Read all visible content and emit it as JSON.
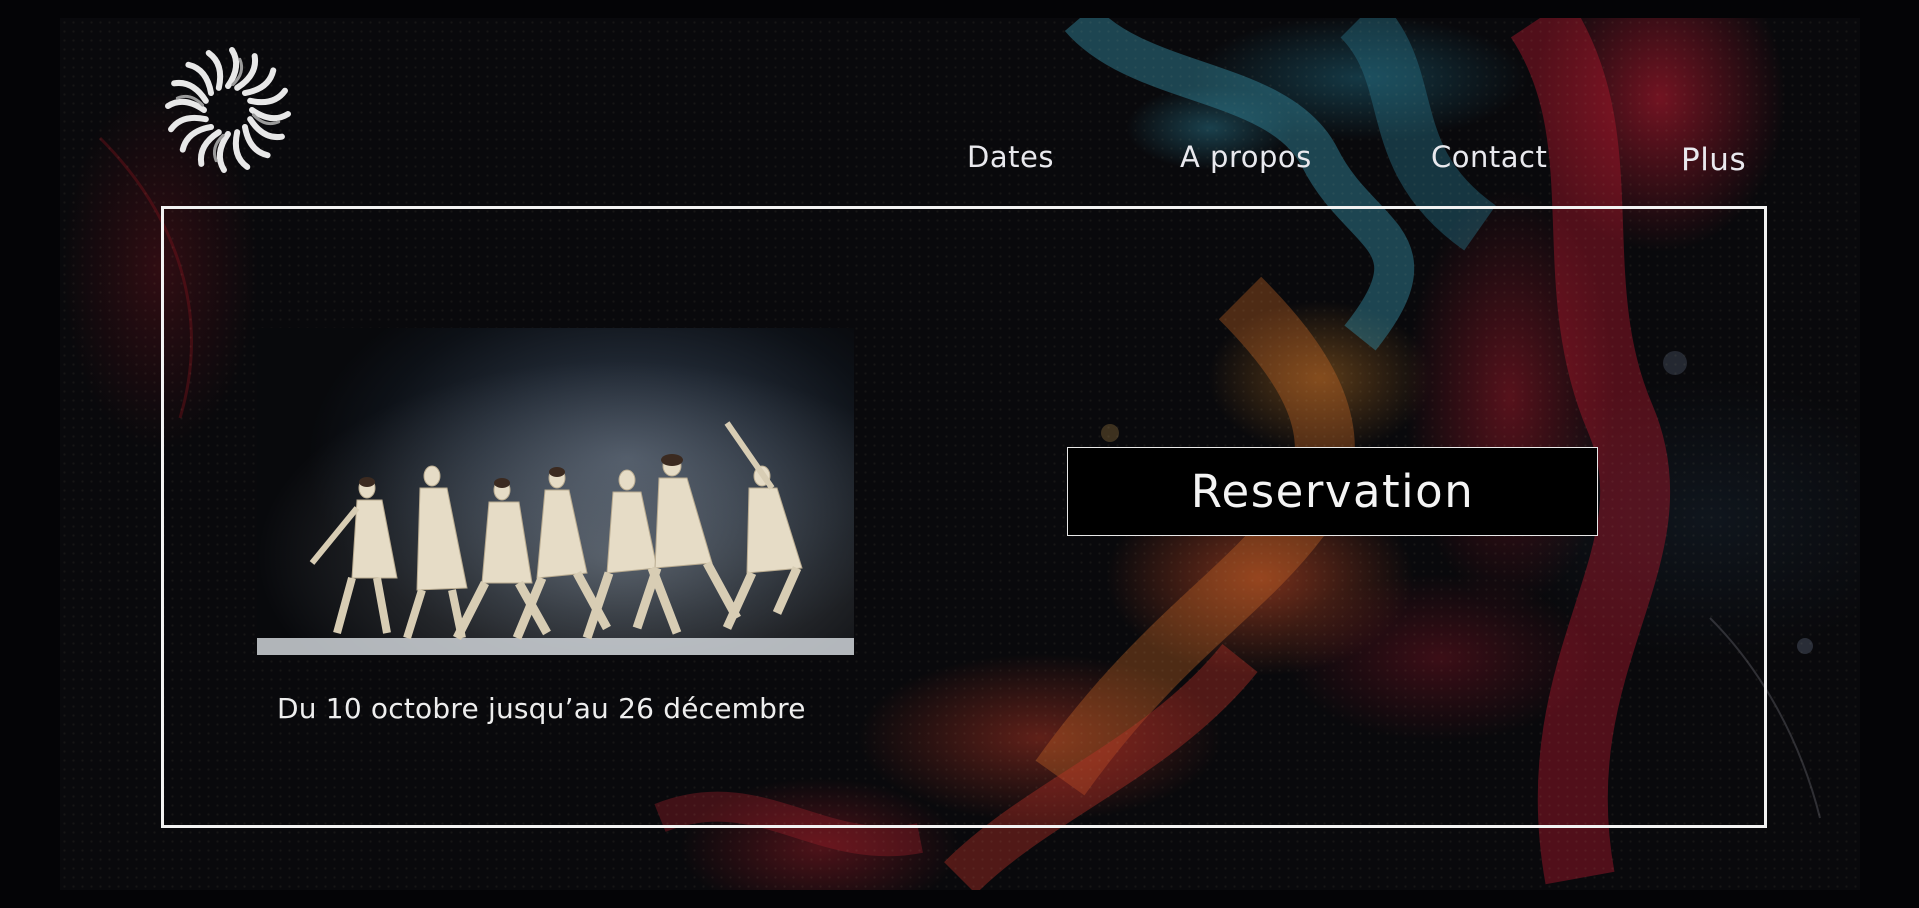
{
  "nav": {
    "items": [
      {
        "label": "Dates"
      },
      {
        "label": "A propos"
      },
      {
        "label": "Contact"
      },
      {
        "label": "Plus"
      }
    ]
  },
  "hero": {
    "date_range": "Du 10 octobre jusqu’au 26 décembre",
    "reservation_label": "Reservation",
    "photo_icon": "dance-performance-photo"
  },
  "logo": {
    "icon": "swirl-logo-icon"
  },
  "colors": {
    "background": "#040406",
    "text": "#eeeeee",
    "frame_border": "#f2f2f2",
    "button_bg": "#000000"
  }
}
